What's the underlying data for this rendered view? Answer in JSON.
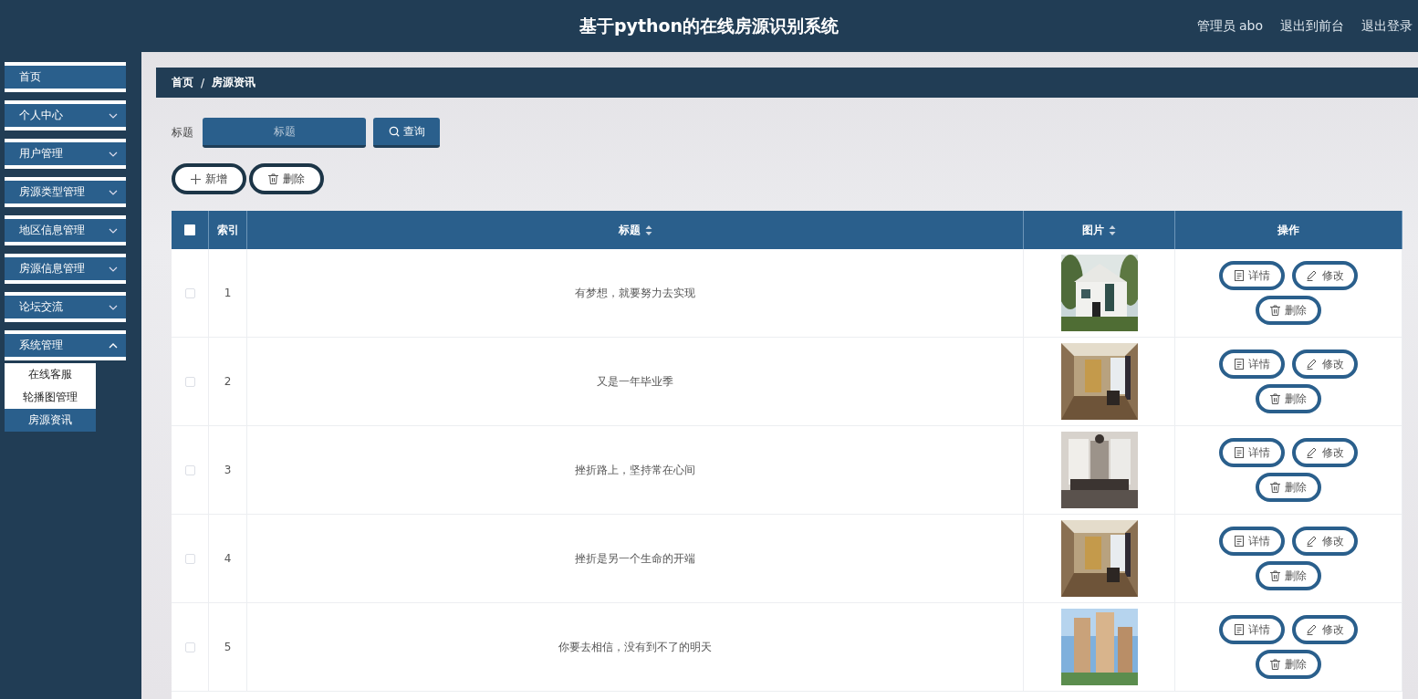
{
  "header": {
    "title": "基于python的在线房源识别系统",
    "links": [
      "管理员 abo",
      "退出到前台",
      "退出登录"
    ]
  },
  "sidebar": {
    "items": [
      {
        "label": "首页",
        "kind": "link"
      },
      {
        "label": "个人中心",
        "kind": "menu",
        "expanded": false
      },
      {
        "label": "用户管理",
        "kind": "menu",
        "expanded": false
      },
      {
        "label": "房源类型管理",
        "kind": "menu",
        "expanded": false
      },
      {
        "label": "地区信息管理",
        "kind": "menu",
        "expanded": false
      },
      {
        "label": "房源信息管理",
        "kind": "menu",
        "expanded": false
      },
      {
        "label": "论坛交流",
        "kind": "menu",
        "expanded": false
      },
      {
        "label": "系统管理",
        "kind": "menu",
        "expanded": true,
        "children": [
          {
            "label": "在线客服",
            "selected": false
          },
          {
            "label": "轮播图管理",
            "selected": false
          },
          {
            "label": "房源资讯",
            "selected": true
          }
        ]
      }
    ]
  },
  "breadcrumb": {
    "items": [
      "首页",
      "房源资讯"
    ],
    "separator": "/"
  },
  "search": {
    "label": "标题",
    "placeholder": "标题",
    "button": "查询"
  },
  "actions": [
    "新增",
    "删除"
  ],
  "table": {
    "select_all": {
      "checked": false
    },
    "columns": [
      {
        "label": "索引",
        "sortable": false
      },
      {
        "label": "标题",
        "sortable": true
      },
      {
        "label": "图片",
        "sortable": true
      },
      {
        "label": "操作",
        "sortable": false
      }
    ],
    "rows": [
      {
        "index": "1",
        "title": "有梦想，就要努力去实现",
        "checked": false,
        "image": {
          "kind": "picture"
        },
        "buttons": [
          "详情",
          "修改",
          "删除"
        ]
      },
      {
        "index": "2",
        "title": "又是一年毕业季",
        "checked": false,
        "image": {
          "kind": "picture"
        },
        "buttons": [
          "详情",
          "修改",
          "删除"
        ]
      },
      {
        "index": "3",
        "title": "挫折路上，坚持常在心间",
        "checked": false,
        "image": {
          "kind": "picture"
        },
        "buttons": [
          "详情",
          "修改",
          "删除"
        ]
      },
      {
        "index": "4",
        "title": "挫折是另一个生命的开端",
        "checked": false,
        "image": {
          "kind": "picture"
        },
        "buttons": [
          "详情",
          "修改",
          "删除"
        ]
      },
      {
        "index": "5",
        "title": "你要去相信，没有到不了的明天",
        "checked": false,
        "image": {
          "kind": "picture"
        },
        "buttons": [
          "详情",
          "修改",
          "删除"
        ]
      }
    ]
  }
}
